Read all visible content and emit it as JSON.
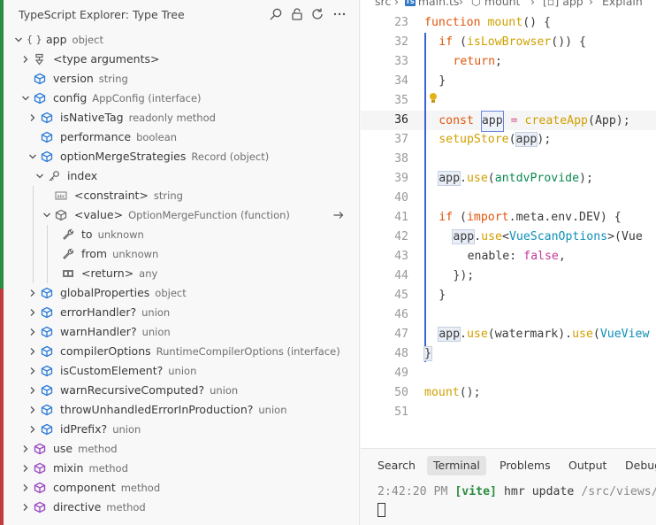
{
  "sidebar": {
    "title": "TypeScript Explorer: Type Tree",
    "header_icons": [
      "search-icon",
      "lock-icon",
      "refresh-icon",
      "more-icon"
    ],
    "tree": [
      {
        "label": "app",
        "desc": "object",
        "icon": "braces"
      },
      {
        "label": "<type arguments>",
        "desc": "",
        "icon": "type-args"
      },
      {
        "label": "version",
        "desc": "string",
        "icon": "cube"
      },
      {
        "label": "config",
        "desc": "AppConfig (interface)",
        "icon": "cube"
      },
      {
        "label": "isNativeTag",
        "desc": "readonly method",
        "icon": "cube"
      },
      {
        "label": "performance",
        "desc": "boolean",
        "icon": "cube"
      },
      {
        "label": "optionMergeStrategies",
        "desc": "Record (object)",
        "icon": "cube"
      },
      {
        "label": "index",
        "desc": "",
        "icon": "key"
      },
      {
        "label": "<constraint>",
        "desc": "string",
        "icon": "abc"
      },
      {
        "label": "<value>",
        "desc": "OptionMergeFunction (function)",
        "icon": "cube-gray"
      },
      {
        "label": "to",
        "desc": "unknown",
        "icon": "wrench"
      },
      {
        "label": "from",
        "desc": "unknown",
        "icon": "wrench"
      },
      {
        "label": "<return>",
        "desc": "any",
        "icon": "return"
      },
      {
        "label": "globalProperties",
        "desc": "object",
        "icon": "cube"
      },
      {
        "label": "errorHandler?",
        "desc": "union",
        "icon": "cube"
      },
      {
        "label": "warnHandler?",
        "desc": "union",
        "icon": "cube"
      },
      {
        "label": "compilerOptions",
        "desc": "RuntimeCompilerOptions (interface)",
        "icon": "cube"
      },
      {
        "label": "isCustomElement?",
        "desc": "union",
        "icon": "cube"
      },
      {
        "label": "warnRecursiveComputed?",
        "desc": "union",
        "icon": "cube"
      },
      {
        "label": "throwUnhandledErrorInProduction?",
        "desc": "union",
        "icon": "cube"
      },
      {
        "label": "idPrefix?",
        "desc": "union",
        "icon": "cube"
      },
      {
        "label": "use",
        "desc": "method",
        "icon": "method"
      },
      {
        "label": "mixin",
        "desc": "method",
        "icon": "method"
      },
      {
        "label": "component",
        "desc": "method",
        "icon": "method"
      },
      {
        "label": "directive",
        "desc": "method",
        "icon": "method"
      }
    ]
  },
  "breadcrumb": {
    "root": "src",
    "file": "main.ts",
    "file_badge": "TS",
    "fn": "mount",
    "sym": "app",
    "explain": "Explain"
  },
  "editor": {
    "lines": [
      "23",
      "32",
      "33",
      "34",
      "35",
      "36",
      "37",
      "38",
      "39",
      "40",
      "41",
      "42",
      "43",
      "44",
      "45",
      "46",
      "47",
      "48",
      "49",
      "50",
      "51"
    ],
    "current_line": "36",
    "code": {
      "function": "function",
      "mount": "mount",
      "paren_brace": "() {",
      "if": "if",
      "isLowBrowser": "isLowBrowser",
      "if_tail": "()) {",
      "return": "return",
      "semi": ";",
      "close": "}",
      "const": "const",
      "app": "app",
      "eq": "=",
      "createApp": "createApp",
      "createApp_args": "(App);",
      "setupStore": "setupStore",
      "setupStore_args": "(app);",
      "use": "use",
      "antdvProvide": "antdvProvide",
      "use_tail": ");",
      "import": "import",
      "meta_env": ".meta.env.DEV) {",
      "VueScanOptions": "VueScanOptions",
      "vue_tail": ">(Vue",
      "enable": "enable:",
      "false": "false",
      "comma": ",",
      "close_call": "});",
      "watermark": "(watermark).",
      "VueView": "VueView",
      "mount_call": "mount",
      "mount_call_tail": "();"
    }
  },
  "panel": {
    "tabs": [
      "Search",
      "Terminal",
      "Problems",
      "Output",
      "Debug"
    ],
    "active_tab": "Terminal",
    "terminal": {
      "time": "2:42:20 PM",
      "tag": "[vite]",
      "msg": "hmr update",
      "path": "/src/views/"
    }
  },
  "colors": {
    "accent": "#3a63d6",
    "cube_blue": "#2c7ad6",
    "method_purple": "#9b4bc0",
    "keyword": "#e0560e",
    "function_name": "#d0a000",
    "string_green": "#0b8a52"
  }
}
